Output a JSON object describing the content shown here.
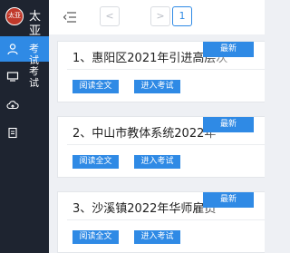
{
  "brand": {
    "logo_text": "太亚",
    "title": "太亚"
  },
  "sidebar": {
    "items": [
      {
        "label": "考试",
        "icon": "user-icon",
        "active": true
      },
      {
        "label": "考试",
        "icon": "monitor-icon",
        "active": false
      },
      {
        "label": "",
        "icon": "cloud-upload-icon",
        "active": false
      },
      {
        "label": "",
        "icon": "clipboard-icon",
        "active": false
      }
    ]
  },
  "pager": {
    "prev": "<",
    "current": "1",
    "next": ">"
  },
  "cards": [
    {
      "title": "1、惠阳区2021年引进高层次",
      "badge": "最新",
      "read_label": "阅读全文",
      "exam_label": "进入考试"
    },
    {
      "title": "2、中山市教体系统2022年",
      "badge": "最新",
      "read_label": "阅读全文",
      "exam_label": "进入考试"
    },
    {
      "title": "3、沙溪镇2022年华师雇员",
      "badge": "最新",
      "read_label": "阅读全文",
      "exam_label": "进入考试"
    }
  ],
  "colors": {
    "accent": "#2f8ae5",
    "sidebar": "#1e2430",
    "background": "#eef0f4"
  }
}
